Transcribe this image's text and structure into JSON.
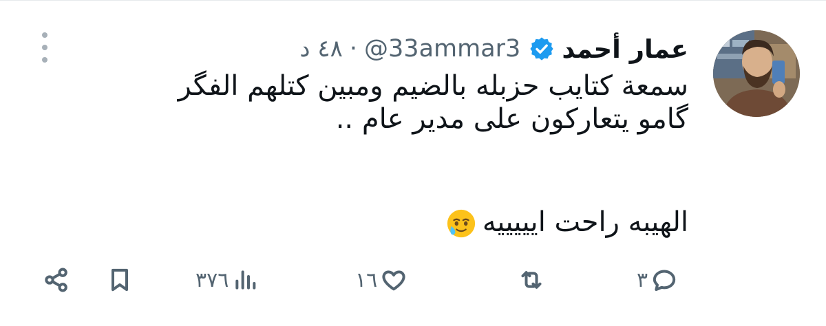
{
  "tweet": {
    "author_name": "عمار أحمد",
    "handle": "@33ammar3",
    "separator": "·",
    "time": "٤٨ د",
    "lines": [
      "سمعة كتايب حزبله بالضيم ومبين كتلهم الفگر",
      "گامو يتعاركون على مدير عام ..",
      "الهيبه راحت ايييييه"
    ],
    "emoji": "face-holding-back-tears"
  },
  "actions": {
    "replies": "٣",
    "reposts": "",
    "likes": "١٦",
    "views": "٣٧٦"
  },
  "colors": {
    "text": "#0f1419",
    "muted": "#536471",
    "verified": "#1d9bf0",
    "border": "#e6e9ec"
  }
}
